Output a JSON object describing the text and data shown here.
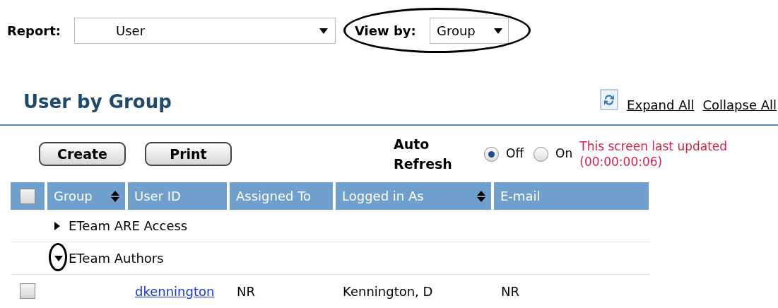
{
  "report": {
    "label": "Report:",
    "value": "User"
  },
  "view_by": {
    "label": "View by:",
    "value": "Group",
    "circled": true
  },
  "title": "User by Group",
  "links": [
    "Expand All",
    "Collapse All"
  ],
  "buttons": [
    "Create",
    "Print"
  ],
  "auto_refresh": {
    "label": "Auto Refresh",
    "options": [
      {
        "label": "Off",
        "selected": true
      },
      {
        "label": "On",
        "selected": false
      }
    ]
  },
  "last_updated": [
    "This screen last updated",
    "(00:00:00:06)"
  ],
  "table": {
    "select_all_checked": false,
    "columns": [
      {
        "label": "Group",
        "sortable": true
      },
      {
        "label": "User ID",
        "sortable": false
      },
      {
        "label": "Assigned To",
        "sortable": false
      },
      {
        "label": "Logged in As",
        "sortable": true
      },
      {
        "label": "E-mail",
        "sortable": false
      }
    ],
    "rows": [
      {
        "kind": "group",
        "label": "ETeam ARE Access",
        "expanded": false,
        "circled": false
      },
      {
        "kind": "group",
        "label": "ETeam Authors",
        "expanded": true,
        "circled": true
      },
      {
        "kind": "user",
        "checked": false,
        "cells": [
          "",
          "dkennington",
          "NR",
          "Kennington, D",
          "NR"
        ]
      }
    ]
  }
}
